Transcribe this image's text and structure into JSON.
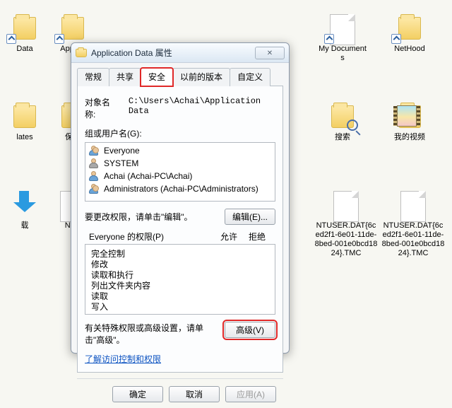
{
  "desktop": {
    "items": [
      {
        "label": "Data",
        "kind": "shortcut"
      },
      {
        "label": "Appli D",
        "kind": "shortcut"
      },
      {
        "label": "My Documents",
        "kind": "shortcut"
      },
      {
        "label": "NetHood",
        "kind": "shortcut"
      },
      {
        "label": "lates",
        "kind": "folder"
      },
      {
        "label": "保存",
        "kind": "folder"
      },
      {
        "label": "搜索",
        "kind": "search-folder"
      },
      {
        "label": "我的视频",
        "kind": "video-folder"
      },
      {
        "label": "载",
        "kind": "download"
      },
      {
        "label": "NTU",
        "kind": "file"
      },
      {
        "label": "NTUSER.DAT{6ced2f1-6e01-11de-8bed-001e0bcd1824}.TMC",
        "kind": "file"
      },
      {
        "label": "NTUSER.DAT{6ced2f1-6e01-11de-8bed-001e0bcd1824}.TMC",
        "kind": "file"
      }
    ]
  },
  "dialog": {
    "title": "Application Data 属性",
    "tabs": {
      "general": "常规",
      "share": "共享",
      "security": "安全",
      "previous": "以前的版本",
      "custom": "自定义"
    },
    "object_label": "对象名称:",
    "object_path": "C:\\Users\\Achai\\Application Data",
    "groups_label": "组或用户名(G):",
    "groups": [
      {
        "name": "Everyone",
        "icon": "multi"
      },
      {
        "name": "SYSTEM",
        "icon": "sys"
      },
      {
        "name": "Achai (Achai-PC\\Achai)",
        "icon": "single"
      },
      {
        "name": "Administrators (Achai-PC\\Administrators)",
        "icon": "multi"
      }
    ],
    "edit_hint": "要更改权限，请单击\"编辑\"。",
    "edit_btn": "编辑(E)...",
    "perm_label_prefix": "Everyone 的权限(P)",
    "perm_allow": "允许",
    "perm_deny": "拒绝",
    "permissions": [
      "完全控制",
      "修改",
      "读取和执行",
      "列出文件夹内容",
      "读取",
      "写入"
    ],
    "adv_hint": "有关特殊权限或高级设置，请单击\"高级\"。",
    "adv_btn": "高级(V)",
    "help_link": "了解访问控制和权限",
    "ok": "确定",
    "cancel": "取消",
    "apply": "应用(A)"
  }
}
